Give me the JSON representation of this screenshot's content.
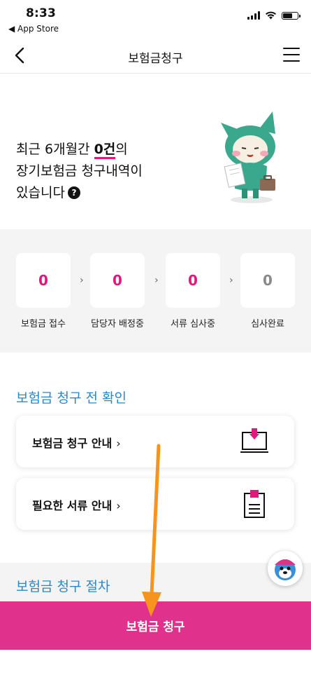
{
  "status_bar": {
    "time": "8:33",
    "back_app": "◀ App Store"
  },
  "nav": {
    "title": "보험금청구",
    "back_icon": "chevron-left-icon",
    "menu_icon": "hamburger-menu-icon"
  },
  "hero": {
    "line1_prefix": "최근 6개월간 ",
    "count": "0건",
    "line1_suffix": "의",
    "line2": "장기보험금 청구내역이",
    "line3": "있습니다",
    "help": "?"
  },
  "steps": [
    {
      "value": "0",
      "label": "보험금 접수",
      "color": "#e0197d"
    },
    {
      "value": "0",
      "label": "담당자 배정중",
      "color": "#e0197d"
    },
    {
      "value": "0",
      "label": "서류 심사중",
      "color": "#e0197d"
    },
    {
      "value": "0",
      "label": "심사완료",
      "color": "#8a8a8a"
    }
  ],
  "step_arrow": "›",
  "check": {
    "title": "보험금 청구 전 확인",
    "cards": [
      {
        "label": "보험금 청구 안내",
        "chevron": "›",
        "icon": "laptop-download-icon"
      },
      {
        "label": "필요한 서류 안내",
        "chevron": "›",
        "icon": "document-icon"
      }
    ]
  },
  "peek_title": "보험금 청구 절차",
  "cta": {
    "label": "보험금 청구"
  },
  "colors": {
    "accent": "#e0197d",
    "cta": "#e0318c",
    "section_title": "#2b88c8",
    "mascot": "#3aa88d",
    "annotation": "#f7941d"
  }
}
